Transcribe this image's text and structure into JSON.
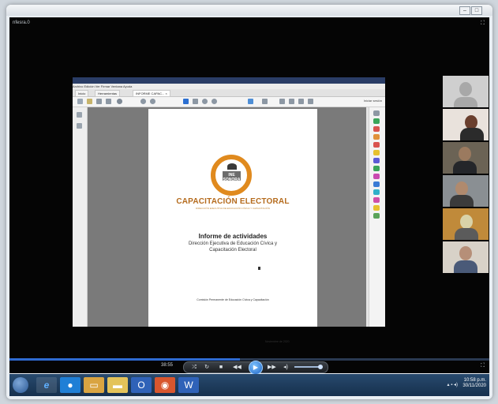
{
  "window": {
    "corner_label": "nfesra.0"
  },
  "document": {
    "logo_text": "INE SONORA",
    "cap_title": "CAPACITACIÓN ELECTORAL",
    "cap_subtitle": "DIRECCIÓN EJECUTIVA DE EDUCACIÓN CÍVICA Y CAPACITACIÓN",
    "report_title": "Informe de actividades",
    "report_line1": "Dirección Ejecutiva de Educación Cívica y",
    "report_line2": "Capacitación Electoral",
    "footer_commission": "Comisión Permanente de Educación Cívica y Capacitación",
    "footer_date": "Noviembre de 2020"
  },
  "acrobat": {
    "menu": "Archivo  Edición  Ver  Firmar  Ventana  Ayuda",
    "tabs": [
      "Inicio",
      "Herramientas",
      "INFORME CAPAC... ×"
    ],
    "share_label": "Iniciar sesión"
  },
  "player": {
    "time": "38:55",
    "progress_fraction": 0.48
  },
  "taskbar": {
    "clock_time": "10:58 p.m.",
    "clock_date": "30/11/2020"
  }
}
